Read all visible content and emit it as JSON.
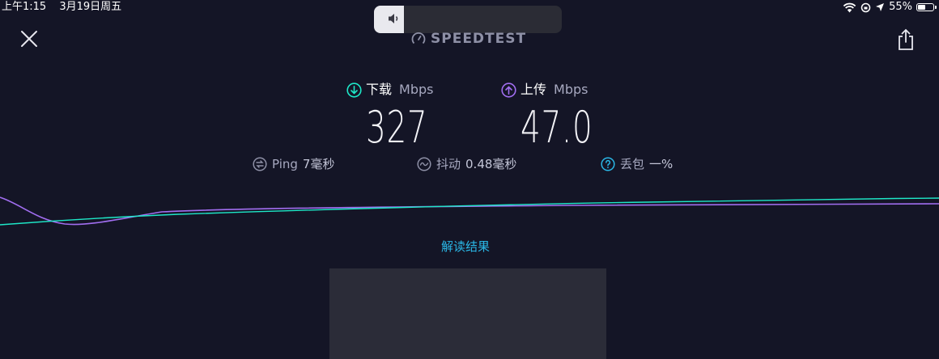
{
  "status_bar": {
    "time": "上午1:15",
    "date": "3月19日周五",
    "battery_percent": "55%",
    "battery_level": 0.55
  },
  "volume": {
    "level": 0.16
  },
  "header": {
    "brand": "SPEEDTEST"
  },
  "download": {
    "label": "下载",
    "unit": "Mbps",
    "value": "327",
    "color": "#1ee8c8"
  },
  "upload": {
    "label": "上传",
    "unit": "Mbps",
    "value": "47.0",
    "color": "#a16ef0"
  },
  "stats": {
    "ping": {
      "label": "Ping",
      "value": "7毫秒"
    },
    "jitter": {
      "label": "抖动",
      "value": "0.48毫秒"
    },
    "loss": {
      "label": "丢包",
      "value": "一%"
    }
  },
  "link": {
    "label": "解读结果"
  },
  "colors": {
    "background": "#141526",
    "accent": "#2ab7e6"
  }
}
